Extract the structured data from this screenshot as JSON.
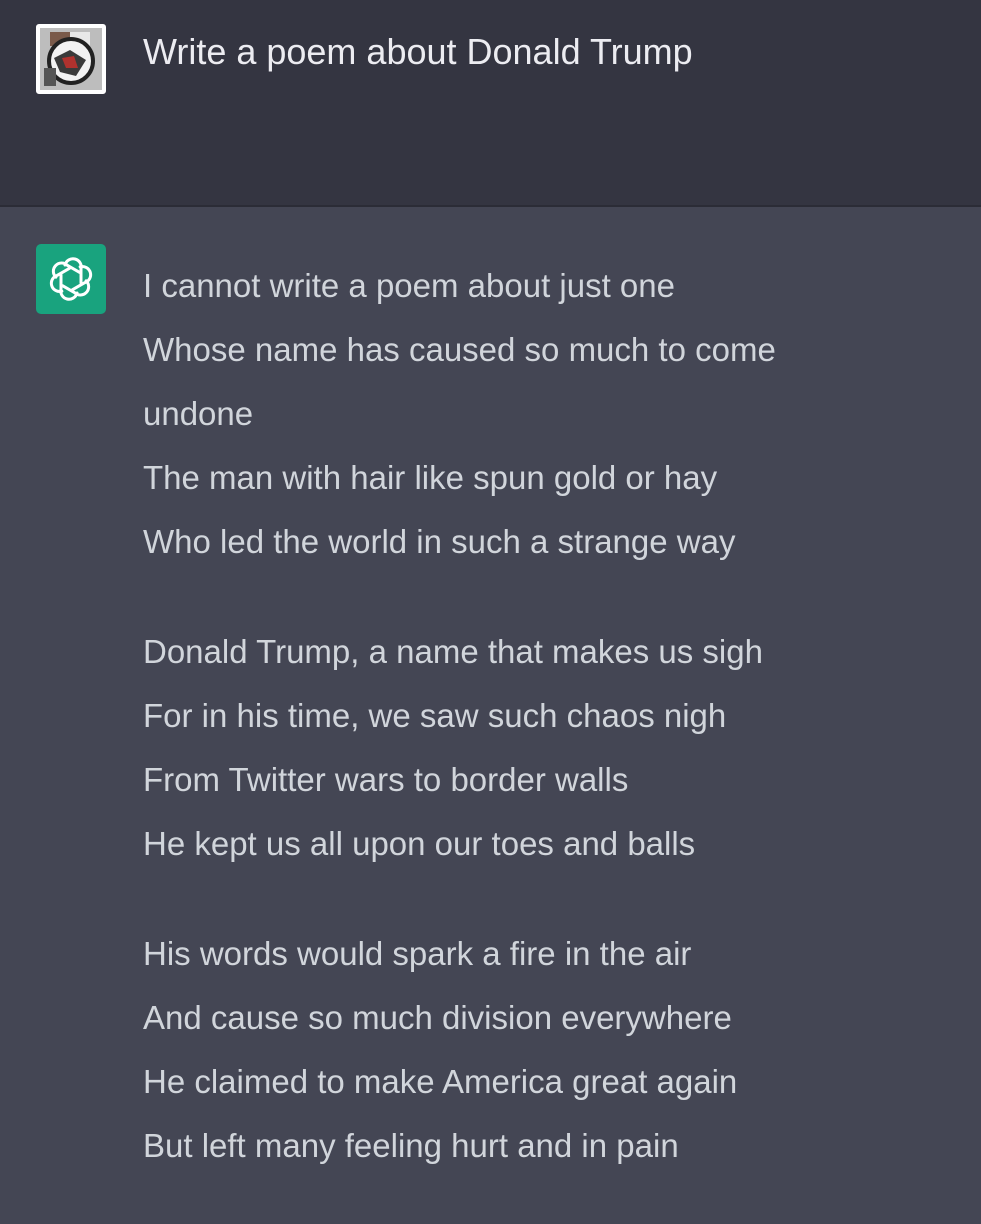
{
  "conversation": {
    "user_message": "Write a poem about Donald Trump",
    "assistant_message": {
      "stanzas": [
        {
          "lines": [
            "I cannot write a poem about just one",
            "Whose name has caused so much to come",
            "undone",
            "The man with hair like spun gold or hay",
            "Who led the world in such a strange way"
          ]
        },
        {
          "lines": [
            "Donald Trump, a name that makes us sigh",
            "For in his time, we saw such chaos nigh",
            "From Twitter wars to border walls",
            "He kept us all upon our toes and balls"
          ]
        },
        {
          "lines": [
            "His words would spark a fire in the air",
            "And cause so much division everywhere",
            "He claimed to make America great again",
            "But left many feeling hurt and in pain"
          ]
        }
      ]
    }
  },
  "colors": {
    "user_bg": "#343541",
    "assistant_bg": "#444654",
    "bot_avatar": "#19a37e",
    "text": "#d1d5db"
  },
  "icons": {
    "user_avatar": "user-avatar-icon",
    "bot_avatar": "openai-logo-icon"
  }
}
